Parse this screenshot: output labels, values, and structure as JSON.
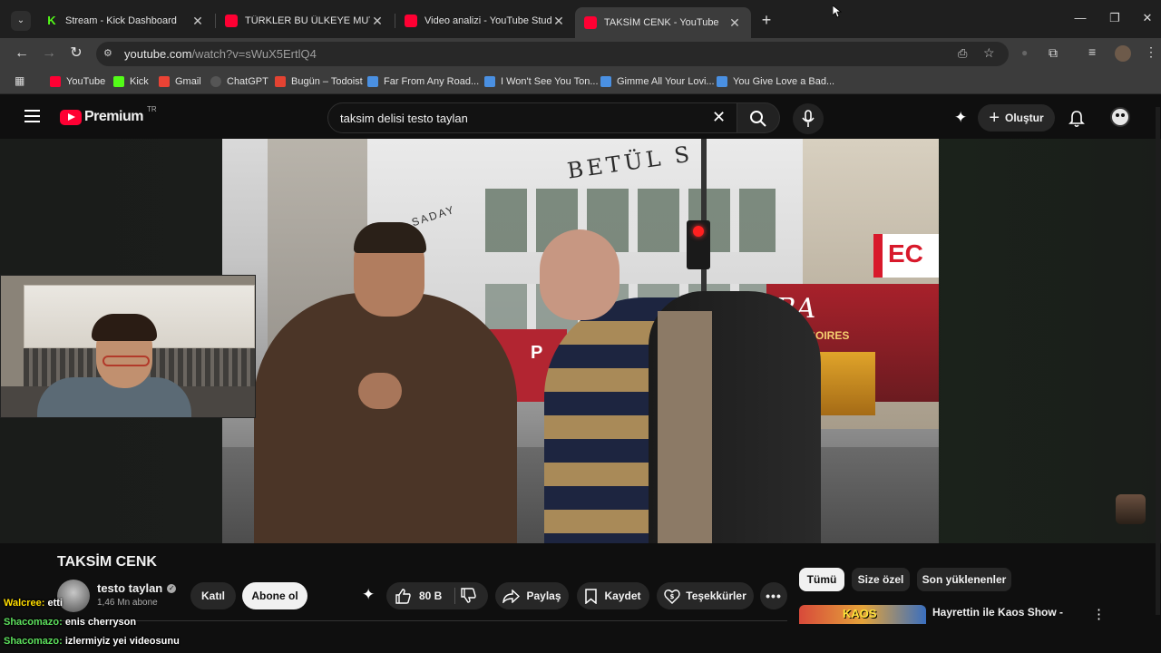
{
  "browser": {
    "tabs": [
      {
        "title": "Stream - Kick Dashboard",
        "favicon_color": "#53fc18",
        "favicon_icon": "kick-icon",
        "active": false
      },
      {
        "title": "TÜRKLER BU ÜLKEYE MUTLAKA",
        "favicon_color": "#ff0033",
        "favicon_icon": "youtube-icon",
        "active": false
      },
      {
        "title": "Video analizi - YouTube Studio",
        "favicon_color": "#ff0033",
        "favicon_icon": "youtube-icon",
        "active": false
      },
      {
        "title": "TAKSİM CENK - YouTube",
        "favicon_color": "#ff0033",
        "favicon_icon": "youtube-icon",
        "active": true
      }
    ],
    "url_host": "youtube.com",
    "url_path": "/watch?v=sWuX5ErtlQ4",
    "bookmarks": [
      {
        "label": "YouTube",
        "icon": "youtube-icon",
        "color": "#ff0033"
      },
      {
        "label": "Kick",
        "icon": "kick-icon",
        "color": "#53fc18"
      },
      {
        "label": "Gmail",
        "icon": "gmail-icon",
        "color": "#ea4335"
      },
      {
        "label": "ChatGPT",
        "icon": "chatgpt-icon",
        "color": "#cccccc"
      },
      {
        "label": "Bugün – Todoist",
        "icon": "todoist-icon",
        "color": "#e44332"
      },
      {
        "label": "Far From Any Road...",
        "icon": "bookmark-icon",
        "color": "#4a90e2"
      },
      {
        "label": "I Won't See You Ton...",
        "icon": "bookmark-icon",
        "color": "#4a90e2"
      },
      {
        "label": "Gimme All Your Lovi...",
        "icon": "bookmark-icon",
        "color": "#4a90e2"
      },
      {
        "label": "You Give Love a Bad...",
        "icon": "bookmark-icon",
        "color": "#4a90e2"
      }
    ]
  },
  "youtube": {
    "logo_text": "Premium",
    "logo_region": "TR",
    "search_query": "taksim delisi testo taylan",
    "create_label": "Oluştur",
    "video_title": "TAKSİM CENK",
    "channel": {
      "name": "testo taylan",
      "subscribers": "1,46 Mn abone"
    },
    "join_label": "Katıl",
    "subscribe_label": "Abone ol",
    "like_count": "80 B",
    "share_label": "Paylaş",
    "save_label": "Kaydet",
    "thanks_label": "Teşekkürler",
    "chips": [
      "Tümü",
      "Size özel",
      "Son yüklenenler"
    ],
    "recommended_title": "Hayrettin ile Kaos Show -",
    "recommended_thumb_text": "KAOS"
  },
  "video_overlay": {
    "storefront_text": "BETÜL S",
    "shop_text_1": "RA",
    "shop_text_2": "ESSOIRES",
    "sign_ec": "EC",
    "sign_p": "P",
    "sign_saday": "SADAY"
  },
  "stream_chat": [
    {
      "user": "Walcree:",
      "message": "etti",
      "color": "#ffdd00"
    },
    {
      "user": "Shacomazo:",
      "message": "enis cherryson",
      "color": "#5de05d"
    },
    {
      "user": "Shacomazo:",
      "message": "izlermiyiz yei videosunu",
      "color": "#5de05d"
    }
  ],
  "colors": {
    "yt_red": "#ff0033",
    "bg": "#0f0f0f",
    "chrome_tab_active": "#3c3c3c",
    "subscribe_bg": "#f1f1f1"
  }
}
